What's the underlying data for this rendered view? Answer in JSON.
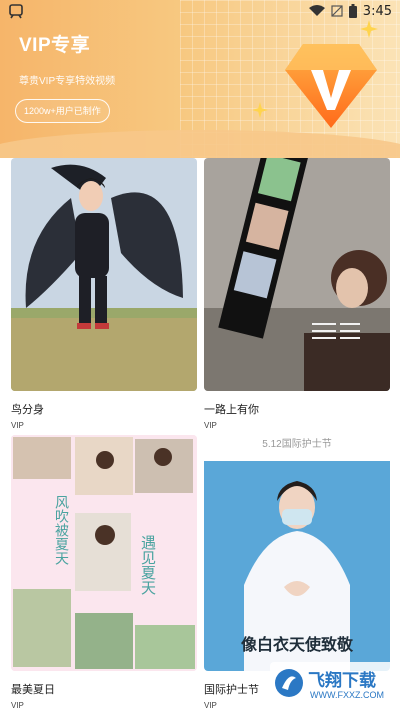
{
  "status_bar": {
    "time": "3:45"
  },
  "header": {
    "title": "VIP专享",
    "subtitle": "尊贵VIP专享特效视频",
    "users_badge": "1200w+用户已制作"
  },
  "cards": [
    {
      "title": "鸟分身",
      "badge": "VIP"
    },
    {
      "title": "一路上有你",
      "badge": "VIP"
    },
    {
      "title": "最美夏日",
      "badge": "VIP"
    },
    {
      "title": "国际护士节",
      "badge": "VIP"
    }
  ],
  "thumb_text": {
    "summer_poster_left": "风吹被夏天",
    "summer_poster_right": "遇见夏天",
    "nurse_caption": "像白衣天使致敬",
    "nurse_top_strip": "5.12国际护士节"
  },
  "watermark": {
    "brand": "飞翔下载",
    "url": "WWW.FXXZ.COM"
  },
  "colors": {
    "accent": "#f7c880",
    "text": "#222222"
  }
}
